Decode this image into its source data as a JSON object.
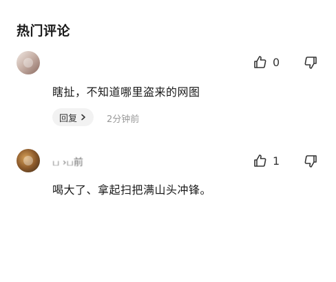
{
  "section": {
    "title": "热门评论"
  },
  "comments": [
    {
      "nickname": "",
      "like_count": "0",
      "text": "瞎扯，不知道哪里盗来的网图",
      "reply_label": "回复",
      "time": "2分钟前"
    },
    {
      "nickname": "ப ›ப前",
      "like_count": "1",
      "text": "喝大了、拿起扫把满山头冲锋。"
    }
  ],
  "icons": {
    "like": "thumbs-up-icon",
    "dislike": "thumbs-down-icon",
    "chevron": "chevron-right-icon"
  },
  "colors": {
    "reply_bg": "#f2f2f2",
    "time_text": "#999999"
  }
}
